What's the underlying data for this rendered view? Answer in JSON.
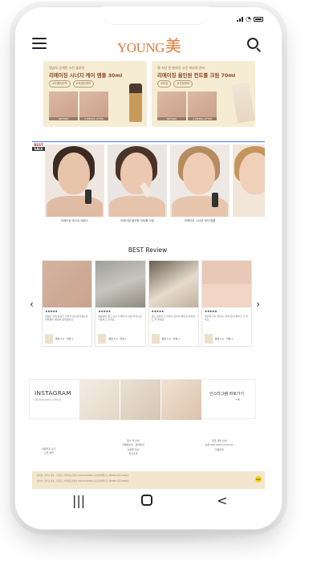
{
  "status": {
    "indicators": [
      "signal",
      "wifi",
      "battery"
    ]
  },
  "header": {
    "logo_text": "YOUNG",
    "logo_char": "美",
    "logo_color": "#e07b3c",
    "icons": [
      "menu-icon",
      "search-icon"
    ]
  },
  "promos": [
    {
      "subtitle": "탱글모 공개된 스킨 솔루션",
      "title": "리에이징 시너지 케어 앰플 30ml",
      "tags": [
        "#주름&탄력",
        "#모공&피지"
      ],
      "before": "BEFORE",
      "after": "4 WEEKS AFTER"
    },
    {
      "subtitle": "탱 지난 한 발자국 고운 피부의 관리",
      "title": "리에이징 올인원 컨트롤 크림 70ml",
      "tags": [
        "#보습",
        "#진정케어"
      ],
      "before": "BEFORE",
      "after": "4 WEEKS AFTER"
    }
  ],
  "gallery": {
    "badge_top": "BEST",
    "badge_bottom": "SALE",
    "items": [
      {
        "caption": "리에이징 퍼스트 에센스"
      },
      {
        "caption": "리에이징 올인원 컨트롤 크림"
      },
      {
        "caption": "리에이징 시너지 케어 앰플"
      },
      {
        "caption": ""
      }
    ]
  },
  "reviews": {
    "title": "BEST Review",
    "cards": [
      {
        "stars": "★★★★★",
        "text": "처음엔 진짜 효과가 있을까 반신반의했는데 피부결이 확실히 달라졌어요.",
        "meta": "평점 5.0 · 리뷰 1"
      },
      {
        "stars": "★★★★★",
        "text": "발림성이 좋고 흡수가 빨라서 아침 저녁으로 사용하고 있어요.",
        "meta": "평점 5.0 · 리뷰 1"
      },
      {
        "stars": "★★★★★",
        "text": "향도 은은하고 자극이 없어서 예민한 피부에도 잘 맞네요.",
        "meta": "평점 5.0 · 리뷰 1"
      },
      {
        "stars": "★★★★★",
        "text": "재구매 의사 있어요. 피부 톤이 밝아진 것 같아요.",
        "meta": "평점 5.0 · 리뷰 1"
      }
    ]
  },
  "instagram": {
    "name": "INSTAGRAM",
    "handle": "@youngme_offical",
    "link_text": "인스타그램 바로가기",
    "link_arrow": "→"
  },
  "footer": {
    "col1": [
      "이용약관 보기",
      "고객 센터"
    ],
    "col2": [
      "회사 및 안내",
      "이메일문의 · 협력제안",
      "쇼핑몰 정보",
      "회사소개"
    ],
    "col3": [
      "입금 계좌 안내",
      "농협 000-0000-0000-00",
      "이용문의"
    ],
    "legal": "상호명 : 영미 | 대표 : 홍길동 | 사업자등록번호 000-00-00000 | 통신판매업신고 제0000-서울-0000호",
    "kakao_label": "talk"
  },
  "navbar": {
    "recents": "|||",
    "back": "<"
  }
}
